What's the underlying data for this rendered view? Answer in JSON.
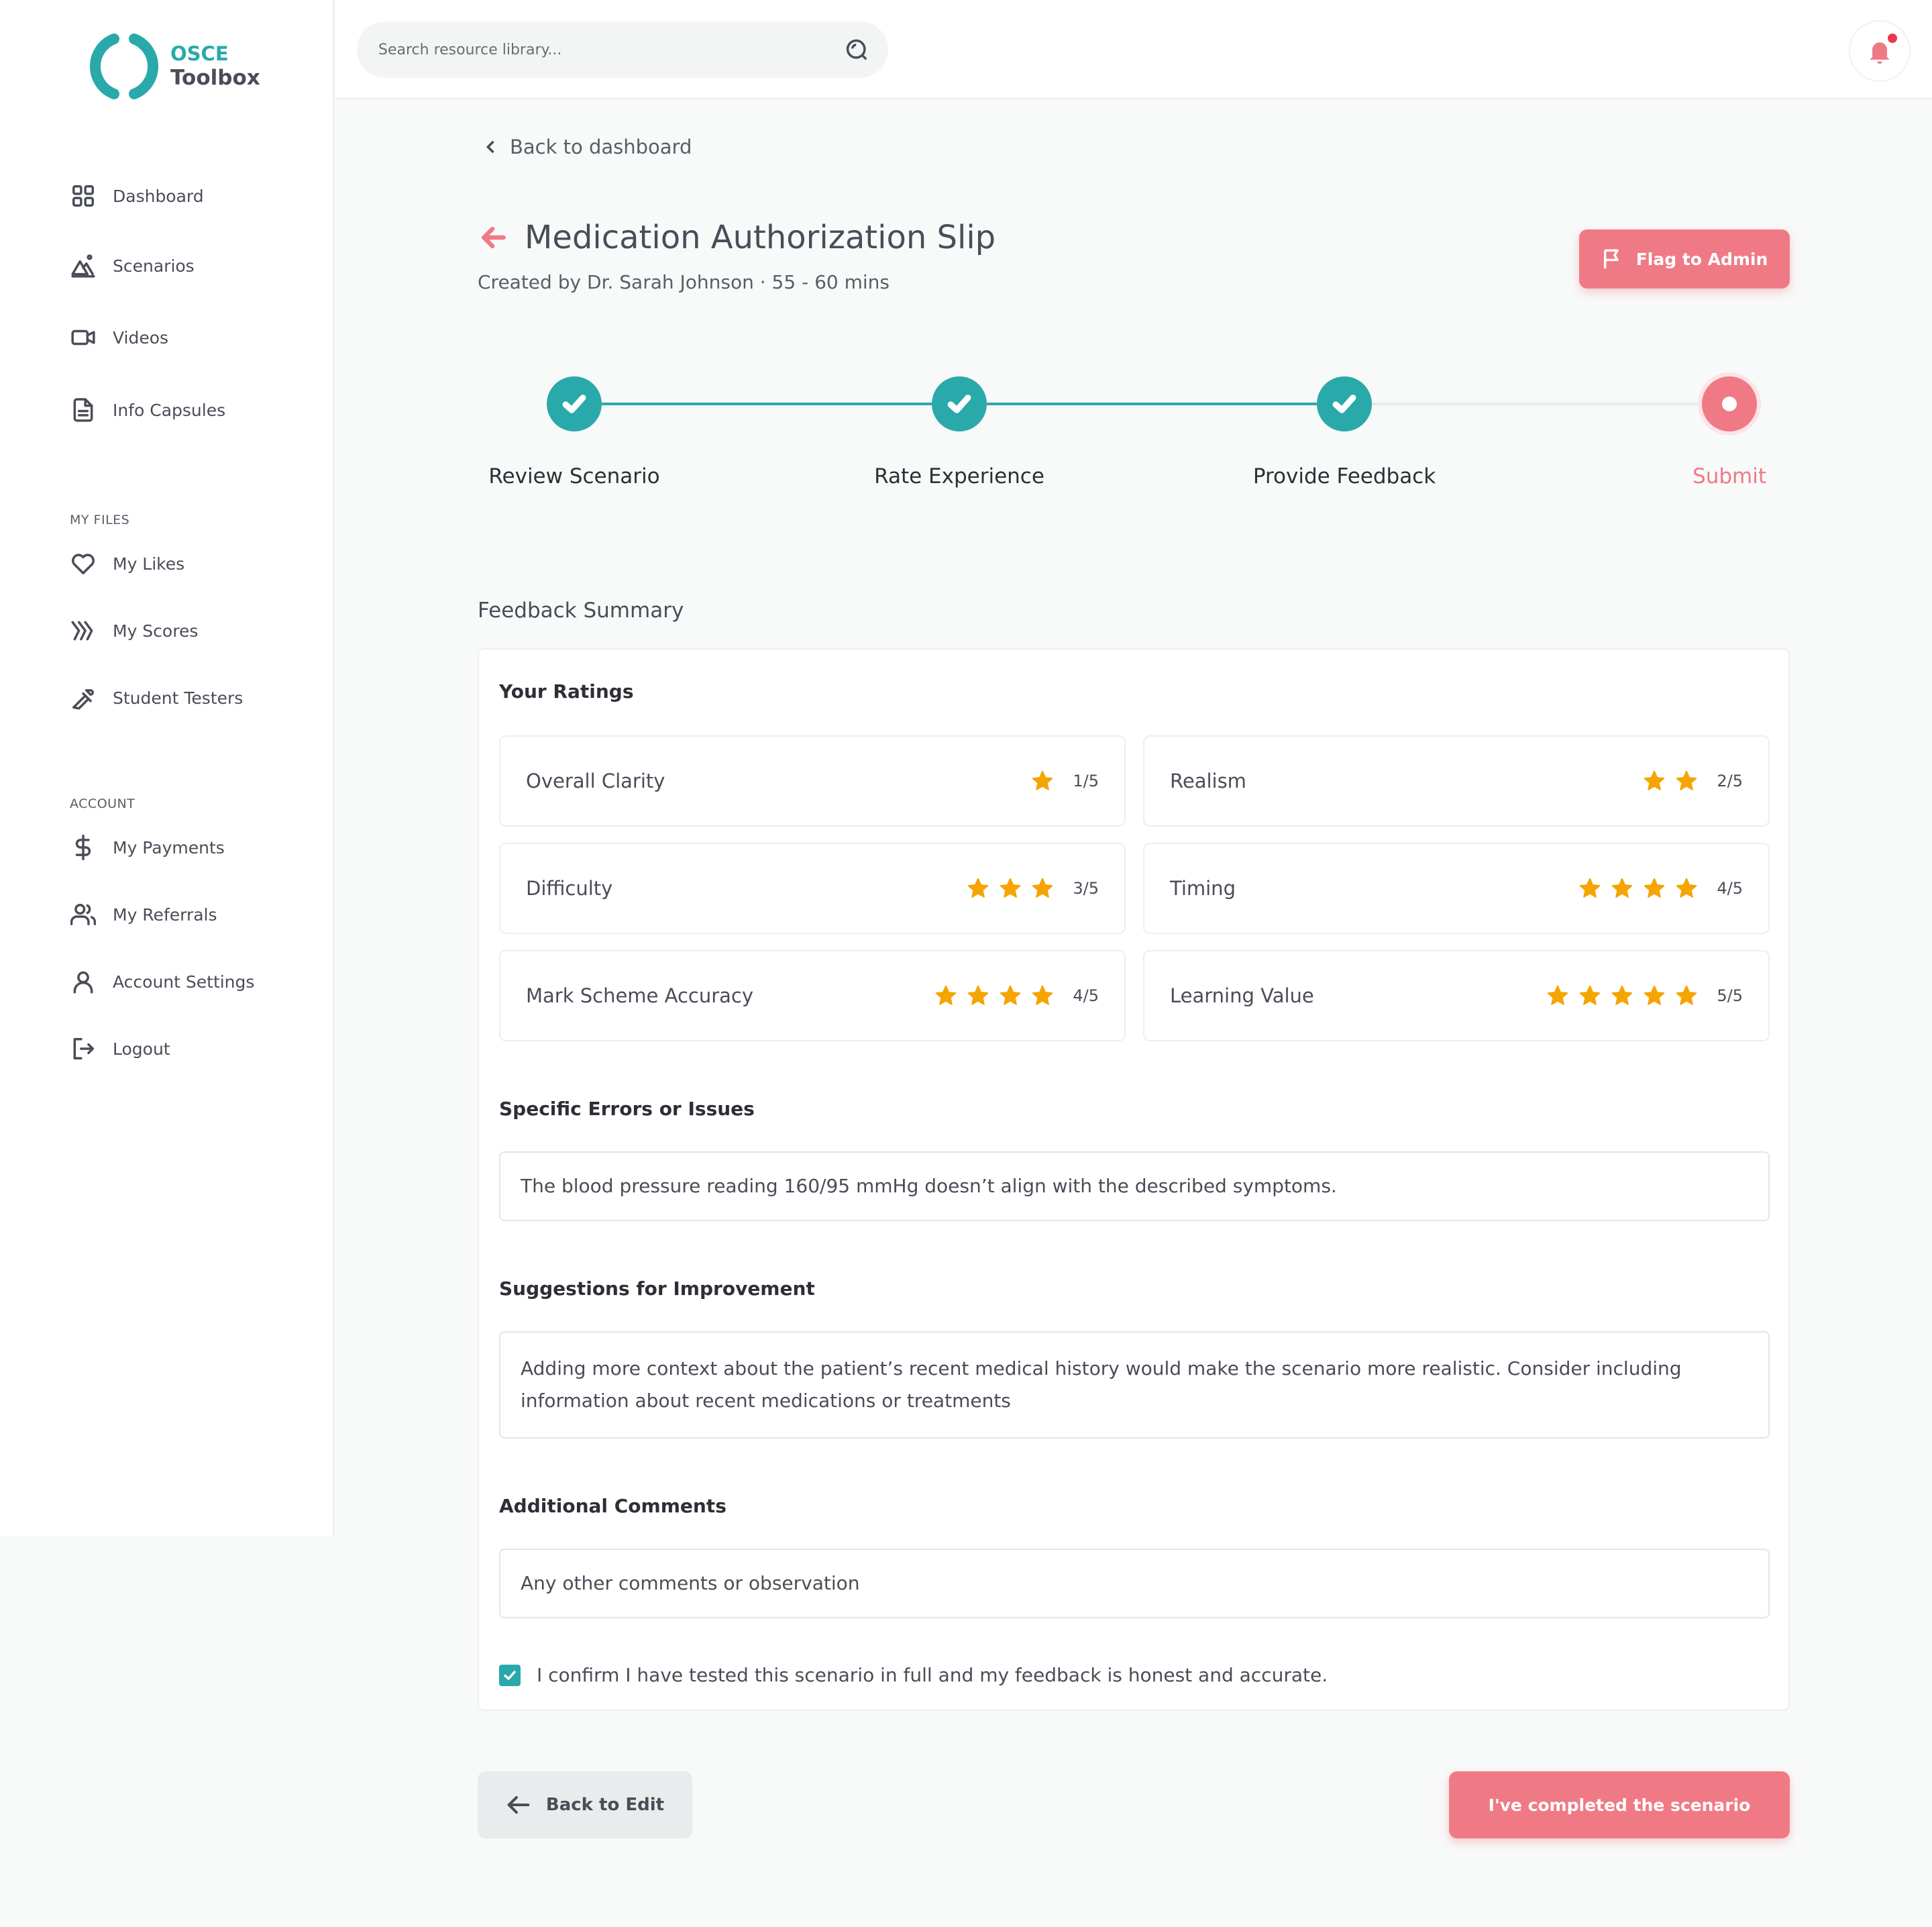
{
  "brand": {
    "line1": "OSCE",
    "line2": "Toolbox",
    "color": "#2aa9ab"
  },
  "search": {
    "placeholder": "Search resource library..."
  },
  "sidebar": {
    "main": [
      {
        "label": "Dashboard",
        "icon": "grid-icon"
      },
      {
        "label": "Scenarios",
        "icon": "scenario-icon"
      },
      {
        "label": "Videos",
        "icon": "video-icon"
      },
      {
        "label": "Info Capsules",
        "icon": "document-icon"
      }
    ],
    "my_files_heading": "MY FILES",
    "my_files": [
      {
        "label": "My Likes",
        "icon": "heart-icon"
      },
      {
        "label": "My Scores",
        "icon": "scores-icon"
      },
      {
        "label": "Student Testers",
        "icon": "pipette-icon"
      }
    ],
    "account_heading": "ACCOUNT",
    "account": [
      {
        "label": "My Payments",
        "icon": "dollar-icon"
      },
      {
        "label": "My Referrals",
        "icon": "users-icon"
      },
      {
        "label": "Account Settings",
        "icon": "user-icon"
      },
      {
        "label": "Logout",
        "icon": "logout-icon"
      }
    ]
  },
  "back_link": "Back to dashboard",
  "page": {
    "title": "Medication Authorization Slip",
    "subtitle": "Created by Dr. Sarah Johnson · 55 - 60 mins",
    "flag_button": "Flag to Admin"
  },
  "steps": [
    {
      "label": "Review Scenario",
      "state": "done"
    },
    {
      "label": "Rate Experience",
      "state": "done"
    },
    {
      "label": "Provide Feedback",
      "state": "done"
    },
    {
      "label": "Submit",
      "state": "current"
    }
  ],
  "summary": {
    "title": "Feedback Summary",
    "ratings_heading": "Your Ratings",
    "ratings": [
      {
        "name": "Overall Clarity",
        "value": 1,
        "score": "1/5"
      },
      {
        "name": "Realism",
        "value": 2,
        "score": "2/5"
      },
      {
        "name": "Difficulty",
        "value": 3,
        "score": "3/5"
      },
      {
        "name": "Timing",
        "value": 4,
        "score": "4/5"
      },
      {
        "name": "Mark Scheme Accuracy",
        "value": 4,
        "score": "4/5"
      },
      {
        "name": "Learning Value",
        "value": 5,
        "score": "5/5"
      }
    ],
    "errors_heading": "Specific Errors or Issues",
    "errors_text": "The blood pressure reading 160/95 mmHg doesn’t align with the described symptoms.",
    "suggestions_heading": "Suggestions for Improvement",
    "suggestions_text": "Adding more context about the patient’s recent medical history would make the scenario more realistic. Consider including information about recent medications or treatments",
    "comments_heading": "Additional Comments",
    "comments_placeholder": "Any other comments or observation",
    "confirm_text": "I confirm I have tested this scenario in full and my feedback is honest and accurate.",
    "confirm_checked": true
  },
  "actions": {
    "back_edit": "Back to Edit",
    "complete": "I've completed the scenario"
  },
  "colors": {
    "accent": "#2aa9ab",
    "primary": "#ef7a85",
    "star": "#f5a400"
  }
}
